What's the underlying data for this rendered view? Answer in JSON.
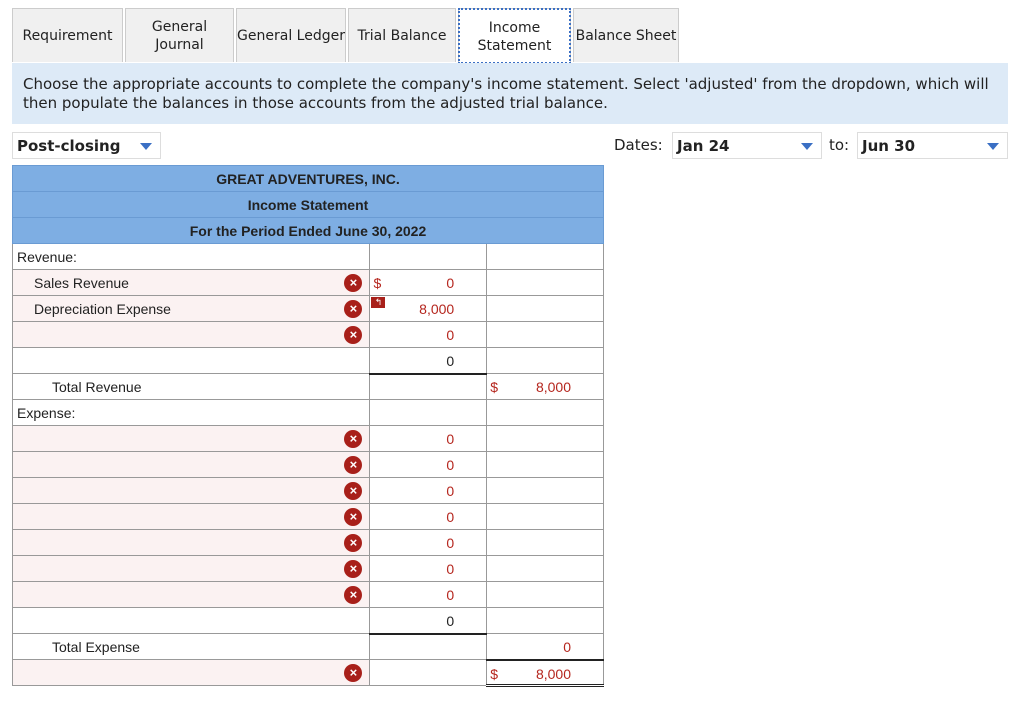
{
  "tabs": [
    {
      "label": "Requirement"
    },
    {
      "label": "General Journal"
    },
    {
      "label": "General Ledger"
    },
    {
      "label": "Trial Balance"
    },
    {
      "label": "Income Statement",
      "active": true
    },
    {
      "label": "Balance Sheet"
    }
  ],
  "instruction": "Choose the appropriate accounts to complete the company's income statement. Select 'adjusted' from the dropdown, which will then populate the balances in those accounts from the adjusted trial balance.",
  "balance_select": {
    "value": "Post-closing"
  },
  "dates": {
    "label": "Dates:",
    "from": "Jan 24",
    "to_label": "to:",
    "to": "Jun 30"
  },
  "statement": {
    "company": "GREAT ADVENTURES, INC.",
    "title": "Income Statement",
    "period": "For the Period Ended June 30, 2022"
  },
  "colors": {
    "header": "#7eaee3",
    "error": "#a8201a",
    "instruction_bg": "#ddeaf7"
  },
  "rows": [
    {
      "label": "Revenue:",
      "indent": 0
    },
    {
      "label": "Sales Revenue",
      "indent": 1,
      "pink": true,
      "x": true,
      "dollar2": "$",
      "col2": "0",
      "red2": true
    },
    {
      "label": "Depreciation Expense",
      "indent": 1,
      "pink": true,
      "x": true,
      "undo": true,
      "col2": "8,000",
      "red2": true
    },
    {
      "label": "",
      "indent": 1,
      "pink": true,
      "x": true,
      "col2": "0",
      "red2": true
    },
    {
      "label": "",
      "indent": 1,
      "col2": "0",
      "ul2": true
    },
    {
      "label": "Total Revenue",
      "indent": 2,
      "dollar3": "$",
      "col3": "8,000",
      "red3": true
    },
    {
      "label": "Expense:",
      "indent": 0
    },
    {
      "label": "",
      "pink": true,
      "x": true,
      "col2": "0",
      "red2": true
    },
    {
      "label": "",
      "pink": true,
      "x": true,
      "col2": "0",
      "red2": true
    },
    {
      "label": "",
      "pink": true,
      "x": true,
      "col2": "0",
      "red2": true
    },
    {
      "label": "",
      "pink": true,
      "x": true,
      "col2": "0",
      "red2": true
    },
    {
      "label": "",
      "pink": true,
      "x": true,
      "col2": "0",
      "red2": true
    },
    {
      "label": "",
      "pink": true,
      "x": true,
      "col2": "0",
      "red2": true
    },
    {
      "label": "",
      "pink": true,
      "x": true,
      "col2": "0",
      "red2": true
    },
    {
      "label": "",
      "col2": "0",
      "ul2": true
    },
    {
      "label": "Total Expense",
      "indent": 2,
      "col3": "0",
      "red3": true,
      "ul3": true
    },
    {
      "label": "",
      "pink": true,
      "x": true,
      "dollar3": "$",
      "col3": "8,000",
      "red3": true,
      "dbl3": true
    }
  ]
}
